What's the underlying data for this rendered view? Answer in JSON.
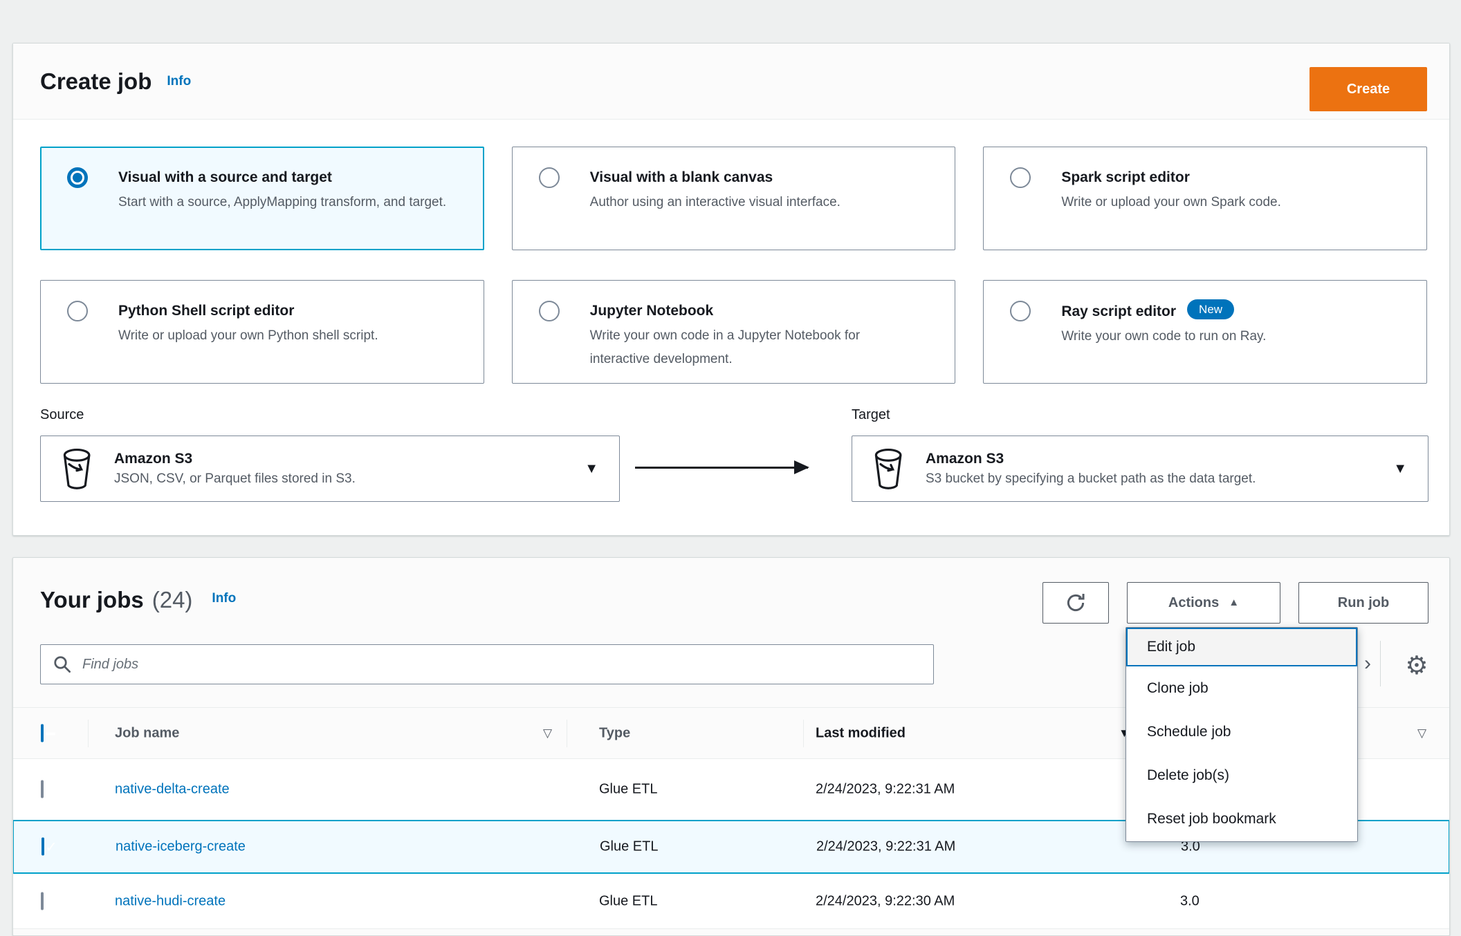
{
  "create_job_panel": {
    "title": "Create job",
    "info_label": "Info",
    "create_button_label": "Create",
    "options": [
      {
        "title": "Visual with a source and target",
        "description": "Start with a source, ApplyMapping transform, and target.",
        "selected": true
      },
      {
        "title": "Visual with a blank canvas",
        "description": "Author using an interactive visual interface.",
        "selected": false
      },
      {
        "title": "Spark script editor",
        "description": "Write or upload your own Spark code.",
        "selected": false
      },
      {
        "title": "Python Shell script editor",
        "description": "Write or upload your own Python shell script.",
        "selected": false
      },
      {
        "title": "Jupyter Notebook",
        "description": "Write your own code in a Jupyter Notebook for interactive development.",
        "selected": false
      },
      {
        "title": "Ray script editor",
        "description": "Write your own code to run on Ray.",
        "selected": false,
        "badge": "New"
      }
    ],
    "source": {
      "label": "Source",
      "name": "Amazon S3",
      "description": "JSON, CSV, or Parquet files stored in S3."
    },
    "target": {
      "label": "Target",
      "name": "Amazon S3",
      "description": "S3 bucket by specifying a bucket path as the data target."
    }
  },
  "jobs_panel": {
    "title": "Your jobs",
    "count": "(24)",
    "info_label": "Info",
    "search_placeholder": "Find jobs",
    "actions_button_label": "Actions",
    "run_job_button_label": "Run job",
    "actions_menu": {
      "items": [
        "Edit job",
        "Clone job",
        "Schedule job",
        "Delete job(s)",
        "Reset job bookmark"
      ],
      "focused_item": "Edit job"
    },
    "table": {
      "columns": {
        "job_name": "Job name",
        "type": "Type",
        "last_modified": "Last modified"
      },
      "rows": [
        {
          "job_name": "native-delta-create",
          "type": "Glue ETL",
          "last_modified": "2/24/2023, 9:22:31 AM",
          "glue_version": "",
          "checked": false,
          "selected": false
        },
        {
          "job_name": "native-iceberg-create",
          "type": "Glue ETL",
          "last_modified": "2/24/2023, 9:22:31 AM",
          "glue_version": "3.0",
          "checked": true,
          "selected": true
        },
        {
          "job_name": "native-hudi-create",
          "type": "Glue ETL",
          "last_modified": "2/24/2023, 9:22:30 AM",
          "glue_version": "3.0",
          "checked": false,
          "selected": false
        }
      ]
    }
  },
  "icons": {
    "sort_none": "▽",
    "sort_descending": "▼",
    "menu_open_caret": "▲",
    "dropdown_caret": "▼",
    "gear": "⚙",
    "pagination_next": "›"
  },
  "colors": {
    "primary_button": "#ec7211",
    "link": "#0073bb",
    "selected_border": "#00a1c9",
    "selected_background": "#f1faff",
    "badge": "#0073bb"
  }
}
